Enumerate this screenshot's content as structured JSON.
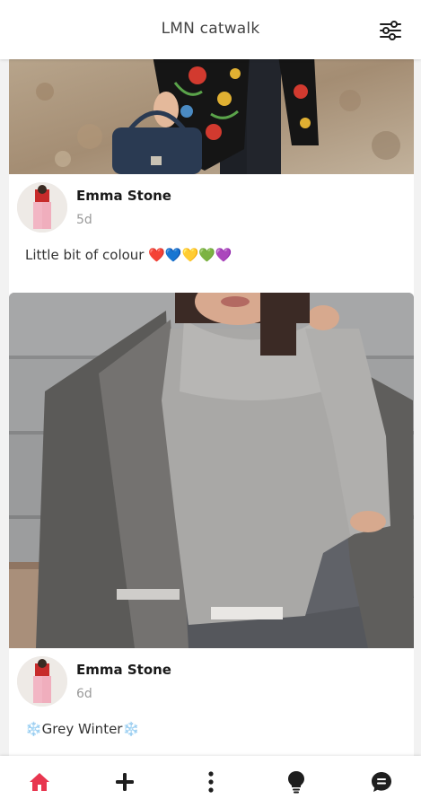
{
  "app": {
    "title": "LMN catwalk"
  },
  "colors": {
    "accent": "#e8364f",
    "nav_icon": "#1e1e1e",
    "muted_text": "#9a9a9a"
  },
  "header": {
    "title": "LMN catwalk",
    "filter_icon": "sliders-icon"
  },
  "posts": [
    {
      "author": "Emma Stone",
      "time": "5d",
      "caption": "Little bit of colour ❤️💙💛💚💜"
    },
    {
      "author": "Emma Stone",
      "time": "6d",
      "caption": "❄️Grey Winter❄️"
    }
  ],
  "bottom_nav": {
    "items": [
      {
        "icon": "home-icon",
        "active": true
      },
      {
        "icon": "plus-icon",
        "active": false
      },
      {
        "icon": "more-vertical-icon",
        "active": false
      },
      {
        "icon": "lightbulb-icon",
        "active": false
      },
      {
        "icon": "chat-icon",
        "active": false
      }
    ]
  }
}
